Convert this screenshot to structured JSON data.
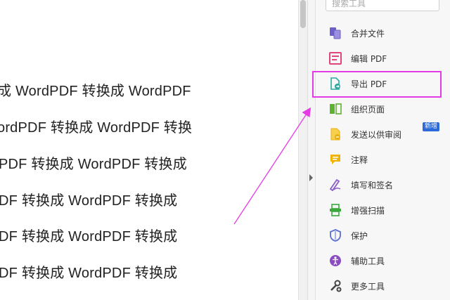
{
  "document": {
    "lines": [
      "成 WordPDF 转换成 WordPDF",
      "ordPDF 转换成 WordPDF 转换",
      "PDF 转换成 WordPDF 转换成",
      "DF 转换成 WordPDF 转换成",
      "DF 转换成 WordPDF 转换成",
      "DF 转换成 WordPDF 转换成"
    ]
  },
  "tools_panel": {
    "search_placeholder": "搜索工具",
    "items": [
      {
        "label": "合并文件",
        "icon": "combine-files-icon",
        "color": "#6d5fc8"
      },
      {
        "label": "编辑 PDF",
        "icon": "edit-pdf-icon",
        "color": "#e0457b"
      },
      {
        "label": "导出 PDF",
        "icon": "export-pdf-icon",
        "color": "#2aa8a0"
      },
      {
        "label": "组织页面",
        "icon": "organize-pages-icon",
        "color": "#5fb130"
      },
      {
        "label": "发送以供审阅",
        "icon": "send-for-review-icon",
        "color": "#e8b010"
      },
      {
        "label": "注释",
        "icon": "comment-icon",
        "color": "#f0b400"
      },
      {
        "label": "填写和签名",
        "icon": "fill-sign-icon",
        "color": "#8a5cc8"
      },
      {
        "label": "增强扫描",
        "icon": "enhance-scan-icon",
        "color": "#3aa83a"
      },
      {
        "label": "保护",
        "icon": "protect-icon",
        "color": "#5a6fd0"
      },
      {
        "label": "辅助工具",
        "icon": "accessibility-icon",
        "color": "#8a4cc0"
      },
      {
        "label": "更多工具",
        "icon": "more-tools-icon",
        "color": "#444444"
      }
    ],
    "new_badge": "新增"
  },
  "annotations": {
    "highlight_color": "#e43be4",
    "arrow_color": "#e43be4"
  }
}
